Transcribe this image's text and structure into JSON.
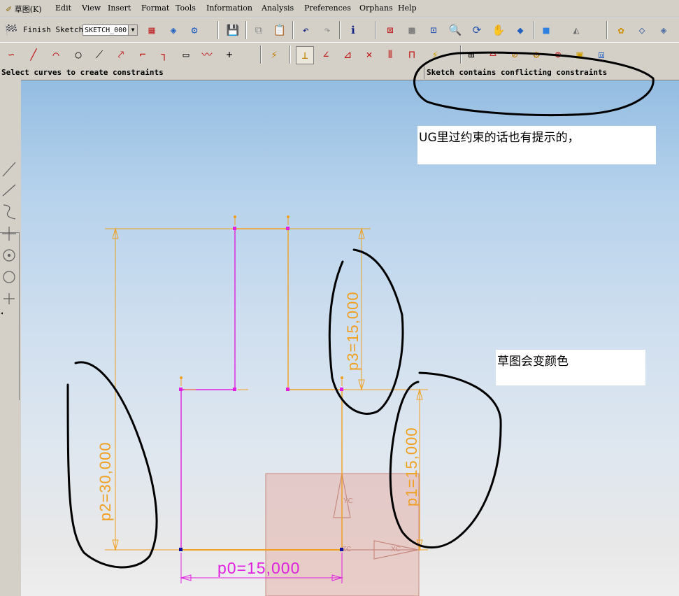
{
  "menu": {
    "sketch": "草图(K)",
    "items": [
      "Edit",
      "View",
      "Insert",
      "Format",
      "Tools",
      "Information",
      "Analysis",
      "Preferences",
      "Orphans",
      "Help"
    ]
  },
  "toolbar1": {
    "finish_sketch_label": "Finish Sketch",
    "sketch_name": "SKETCH_000"
  },
  "status": {
    "prompt": "Select curves to create constraints",
    "message": "Sketch contains conflicting constraints"
  },
  "notes": {
    "constraint_hint": "UG里过约束的话也有提示的，",
    "color_change": "草图会变颜色"
  },
  "dimensions": {
    "p0": "p0=15,000",
    "p1": "p1=15,000",
    "p2": "p2=30,000",
    "p3": "p3=15,000"
  },
  "axes": {
    "yc": "YC",
    "xc": "XC",
    "zc": "ZC"
  },
  "colors": {
    "constraint_orange": "#f0a020",
    "conflict_magenta": "#e020e0",
    "annotation_black": "#000000",
    "datum_fill": "#e4b8b0",
    "datum_stroke": "#c88a80"
  },
  "icons": {
    "toolbar1": [
      "finish-sketch-flag-icon",
      "sketch-create-icon",
      "reattach-icon",
      "sketch-settings-icon",
      "save-icon",
      "copy-icon",
      "paste-icon",
      "undo-icon",
      "redo-icon",
      "info-icon",
      "fit-icon",
      "orient-icon",
      "zoom-area-icon",
      "zoom-icon",
      "rotate-icon",
      "pan-icon",
      "snap-view-icon",
      "shaded-cube-icon",
      "layer-icon",
      "color-icon",
      "hide-icon",
      "show-icon"
    ],
    "toolbar2": [
      "profile-icon",
      "line-icon",
      "arc-icon",
      "circle-icon",
      "quick-trim-icon",
      "quick-extend-icon",
      "fillet-icon",
      "corner-icon",
      "rectangle-icon",
      "studio-spline-icon",
      "point-icon",
      "inferred-dimension-icon",
      "constraints-icon",
      "auto-constraint-icon",
      "show-constraints-icon",
      "convert-reference-icon",
      "alternate-solution-icon",
      "animate-icon",
      "mirror-icon",
      "offset-icon",
      "project-icon",
      "add-extracted-icon",
      "update-icon"
    ],
    "left_panel": [
      "line-tool-icon",
      "diagonal-tool-icon",
      "spline-tool-icon",
      "tangent-tool-icon",
      "center-point-icon",
      "circle-tool-icon",
      "cross-tool-icon"
    ]
  }
}
